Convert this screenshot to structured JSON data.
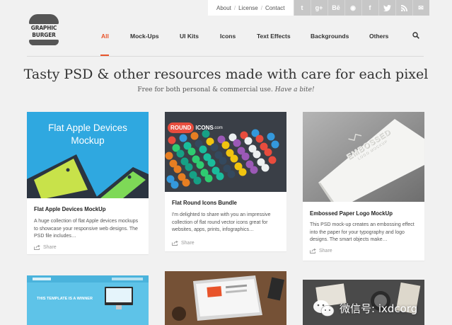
{
  "topbar": {
    "links": [
      "About",
      "License",
      "Contact"
    ],
    "social_icons": [
      {
        "name": "tumblr-icon",
        "glyph": "t"
      },
      {
        "name": "googleplus-icon",
        "glyph": "g+"
      },
      {
        "name": "behance-icon",
        "glyph": "Bē"
      },
      {
        "name": "dribbble-icon",
        "glyph": "◉"
      },
      {
        "name": "facebook-icon",
        "glyph": "f"
      },
      {
        "name": "twitter-icon",
        "glyph": "🐦"
      },
      {
        "name": "rss-icon",
        "glyph": "◔"
      },
      {
        "name": "mail-icon",
        "glyph": "✉"
      }
    ]
  },
  "logo": {
    "line1": "GRAPHIC",
    "line2": "BURGER"
  },
  "nav": {
    "items": [
      "All",
      "Mock-Ups",
      "UI Kits",
      "Icons",
      "Text Effects",
      "Backgrounds",
      "Others"
    ],
    "active_index": 0
  },
  "hero": {
    "title": "Tasty PSD & other resources made with care for each pixel",
    "subtitle_plain": "Free for both personal & commercial use.",
    "subtitle_em": "Have a bite!"
  },
  "cards": [
    {
      "thumb_text_1": "Flat Apple Devices",
      "thumb_text_2": "Mockup",
      "title": "Flat Apple Devices MockUp",
      "desc": "A huge collection of flat Apple devices mockups to showcase your responsive web designs. The PSD file includes…",
      "share": "Share"
    },
    {
      "thumb_brand_1": "ROUND",
      "thumb_brand_2": "ICONS",
      "thumb_brand_3": ".com",
      "title": "Flat Round Icons Bundle",
      "desc": "I'm delighted to share with you an impressive collection of flat round vector icons great for websites, apps, prints, infographics…",
      "share": "Share"
    },
    {
      "thumb_text_1": "EMBOSSED",
      "thumb_text_2": "LOGO MOCKUP",
      "title": "Embossed Paper Logo MockUp",
      "desc": "This PSD mock-up creates an embossing effect into the paper for your typography and logo designs. The smart objects make…",
      "share": "Share"
    }
  ],
  "second_row": {
    "card1_label": "THIS TEMPLATE IS A WINNER"
  },
  "watermark": {
    "text": "微信号: ixdcorg"
  },
  "colors": {
    "accent": "#e8542b",
    "card_blue": "#2fa8e0",
    "dark_bg": "#3a3f47"
  }
}
